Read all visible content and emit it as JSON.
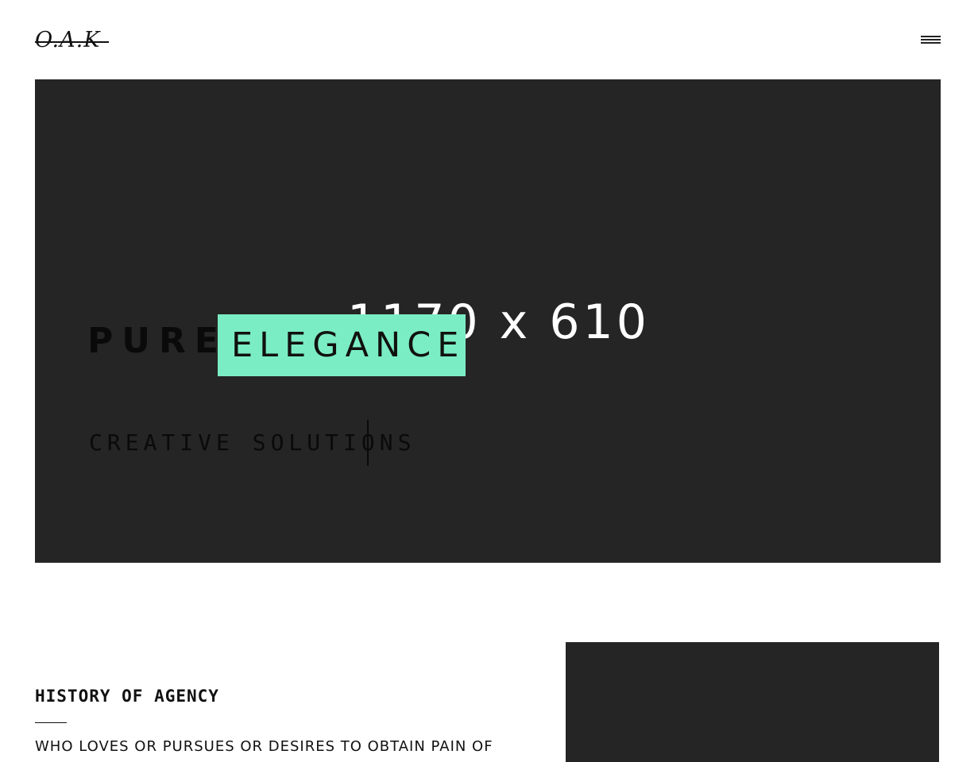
{
  "header": {
    "logo_text": "O.A.K",
    "menu_icon": "hamburger-menu-icon"
  },
  "hero": {
    "placeholder_text": "1170 x 610",
    "word_plain": "PURE",
    "word_highlight": "ELEGANCE",
    "typed_text": "CREATIVE SOLUTIONS",
    "highlight_color": "#7bedc4",
    "background_color": "#252525"
  },
  "history": {
    "title": "HISTORY OF AGENCY",
    "body": "WHO LOVES OR PURSUES OR DESIRES TO OBTAIN PAIN OF"
  }
}
